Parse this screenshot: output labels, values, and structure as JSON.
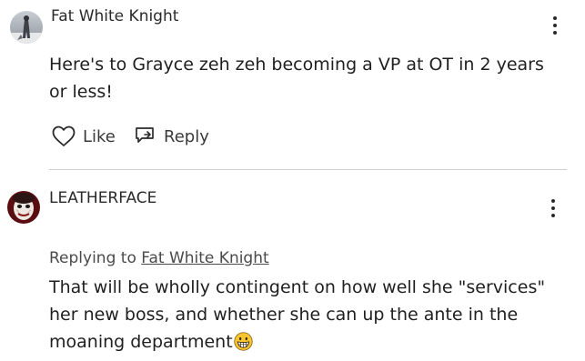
{
  "comments": [
    {
      "author": "Fat White Knight",
      "avatar_icon": "snowy-figure-avatar",
      "text": "Here's to Grayce zeh zeh becoming a VP at OT in 2 years or less!",
      "actions": {
        "like_label": "Like",
        "reply_label": "Reply"
      },
      "menu_icon": "more-vertical-icon"
    },
    {
      "author": "LEATHERFACE",
      "avatar_icon": "leatherface-mask-avatar",
      "replying_prefix": "Replying to",
      "replying_to": "Fat White Knight",
      "text": "That will be wholly contingent on how well she \"services\" her new boss, and whether she can up the ante in the moaning department",
      "emoji": "grinning-face-emoji",
      "menu_icon": "more-vertical-icon"
    }
  ],
  "colors": {
    "divider": "#cfcfcf",
    "text": "#1f1f1f",
    "muted": "#4a4a4a",
    "emoji_face": "#f7c62f"
  }
}
